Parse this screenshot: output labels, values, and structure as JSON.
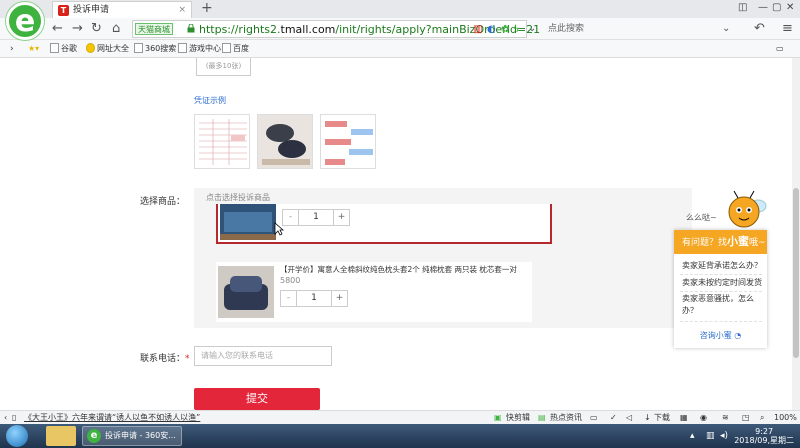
{
  "browser": {
    "tab_title": "投诉申请",
    "tab_close": "×",
    "new_tab": "+",
    "badge": "天猫商城",
    "url_prefix": "https://rights2.",
    "url_domain": "tmall.com",
    "url_rest": "/init/rights/apply?mainBizOrderId=21",
    "search_placeholder": "点此搜索"
  },
  "bookmarks": [
    "谷歌",
    "网址大全",
    "360搜索",
    "游戏中心",
    "百度"
  ],
  "page": {
    "upload_hint": "(最多10张)",
    "proof_example_link": "凭证示例",
    "goods_label": "选择商品：",
    "goods_placeholder": "点击选择投诉商品",
    "item1_qty": "1",
    "item2_title": "【开学价】寓意人全棉斜纹纯色枕头套2个 纯棉枕套 两只装 枕芯套一对",
    "item2_price": "5800",
    "item2_qty": "1",
    "stepper_minus": "-",
    "stepper_plus": "+",
    "phone_label": "联系电话：",
    "phone_required": "*",
    "phone_placeholder": "请输入您的联系电话",
    "submit_label": "提交"
  },
  "help_widget": {
    "bubble": "么么哒~",
    "head_prefix": "有问题？找",
    "head_name": "小蜜",
    "head_suffix": "哦~",
    "questions": [
      "卖家延背承诺怎么办？",
      "卖家未按约定时间发货",
      "卖家恶意骚扰，怎么办？"
    ],
    "contact": "咨询小蜜"
  },
  "statusbar": {
    "news": "《大王小王》六年来谓请“诱人以鱼不如诱人以渔”",
    "speedup": "快剪辑",
    "hot": "热点资讯",
    "download": "下载",
    "zoom": "100%"
  },
  "taskbar": {
    "active_window": "投诉申请 - 360安...",
    "time": "9:27",
    "date": "2018/09,星期二"
  },
  "colors": {
    "accent_red": "#e3263a",
    "help_orange": "#f5a623",
    "browser_green": "#3fb33f"
  }
}
